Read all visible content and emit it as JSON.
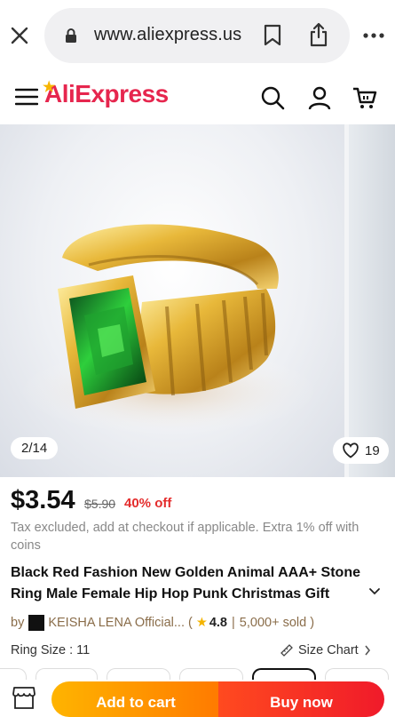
{
  "browser": {
    "url": "www.aliexpress.us"
  },
  "header": {
    "logo_text": "AliExpress",
    "brand_color": "#e6264e"
  },
  "gallery": {
    "counter": "2/14",
    "likes": "19"
  },
  "product": {
    "price": "$3.54",
    "original_price": "$5.90",
    "discount": "40% off",
    "tax_note": "Tax excluded, add at checkout if applicable. Extra 1% off with coins",
    "title": "Black Red Fashion New Golden Animal AAA+ Stone Ring Male Female Hip Hop Punk Christmas Gift",
    "seller_prefix": "by",
    "seller_name": "KEISHA LENA Official...",
    "rating_open": "(",
    "rating": "4.8",
    "separator": "|",
    "sold": "5,000+ sold",
    "rating_close": ")",
    "ring_size_label": "Ring Size",
    "ring_size_sep": " : ",
    "ring_size_value": "11",
    "size_chart": "Size Chart"
  },
  "actions": {
    "add_to_cart": "Add to cart",
    "buy_now": "Buy now"
  }
}
